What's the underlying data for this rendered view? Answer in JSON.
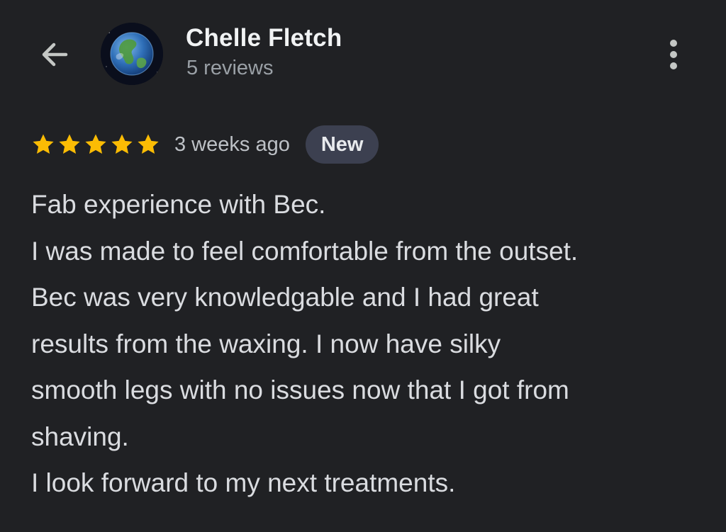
{
  "header": {
    "reviewer_name": "Chelle Fletch",
    "review_count": "5 reviews",
    "back_icon": "arrow-left-icon",
    "more_icon": "more-vert-icon",
    "avatar": "earth-globe-avatar"
  },
  "review": {
    "rating": 5,
    "rating_max": 5,
    "time_ago": "3 weeks ago",
    "badge": "New",
    "lines": [
      "Fab experience with Bec.",
      "I was made to feel comfortable from the outset.",
      "Bec was very knowledgable and I had great",
      "results from the waxing. I now have silky",
      "smooth legs with no issues now that I got from",
      "shaving.",
      "I look forward to my next treatments."
    ]
  },
  "colors": {
    "background": "#202124",
    "star": "#fbbc04",
    "badge_bg": "#3c4050",
    "text_primary": "#f1f3f4",
    "text_secondary": "#9aa0a6"
  }
}
